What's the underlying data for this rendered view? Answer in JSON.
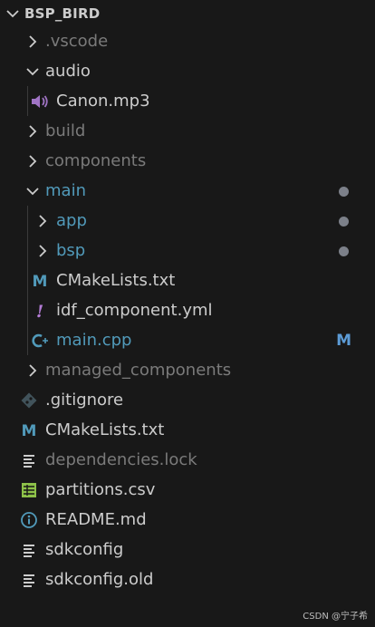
{
  "root": {
    "title": "BSP_BIRD",
    "expanded": true
  },
  "colors": {
    "bg": "#181818",
    "text": "#cccccc",
    "dim": "#7a7a7a",
    "blue": "#519aba",
    "modified": "#7c8089",
    "m_badge": "#5c9bd6",
    "audio_icon": "#a074c4",
    "yml_icon": "#b47cd6",
    "csv_icon": "#8dc149"
  },
  "items": [
    {
      "label": ".vscode",
      "kind": "folder",
      "expanded": false,
      "dim": true,
      "icon": "chevron-right-icon"
    },
    {
      "label": "audio",
      "kind": "folder",
      "expanded": true,
      "dim": false,
      "icon": "chevron-down-icon"
    },
    {
      "label": "Canon.mp3",
      "kind": "file",
      "icon": "audio-icon"
    },
    {
      "label": "build",
      "kind": "folder",
      "expanded": false,
      "dim": true,
      "icon": "chevron-right-icon"
    },
    {
      "label": "components",
      "kind": "folder",
      "expanded": false,
      "dim": true,
      "icon": "chevron-right-icon"
    },
    {
      "label": "main",
      "kind": "folder",
      "expanded": true,
      "modified_dot": true,
      "icon": "chevron-down-icon"
    },
    {
      "label": "app",
      "kind": "folder",
      "expanded": false,
      "modified_dot": true,
      "icon": "chevron-right-icon"
    },
    {
      "label": "bsp",
      "kind": "folder",
      "expanded": false,
      "modified_dot": true,
      "icon": "chevron-right-icon"
    },
    {
      "label": "CMakeLists.txt",
      "kind": "file",
      "icon": "cmake-icon"
    },
    {
      "label": "idf_component.yml",
      "kind": "file",
      "icon": "yaml-icon"
    },
    {
      "label": "main.cpp",
      "kind": "file",
      "badge": "M",
      "icon": "cpp-icon"
    },
    {
      "label": "managed_components",
      "kind": "folder",
      "expanded": false,
      "dim": true,
      "icon": "chevron-right-icon"
    },
    {
      "label": ".gitignore",
      "kind": "file",
      "icon": "git-icon"
    },
    {
      "label": "CMakeLists.txt",
      "kind": "file",
      "icon": "cmake-icon"
    },
    {
      "label": "dependencies.lock",
      "kind": "file",
      "dim": true,
      "icon": "lines-icon"
    },
    {
      "label": "partitions.csv",
      "kind": "file",
      "icon": "csv-icon"
    },
    {
      "label": "README.md",
      "kind": "file",
      "icon": "info-icon"
    },
    {
      "label": "sdkconfig",
      "kind": "file",
      "icon": "lines-icon"
    },
    {
      "label": "sdkconfig.old",
      "kind": "file",
      "icon": "lines-icon"
    }
  ],
  "watermark": "CSDN @宁子希"
}
